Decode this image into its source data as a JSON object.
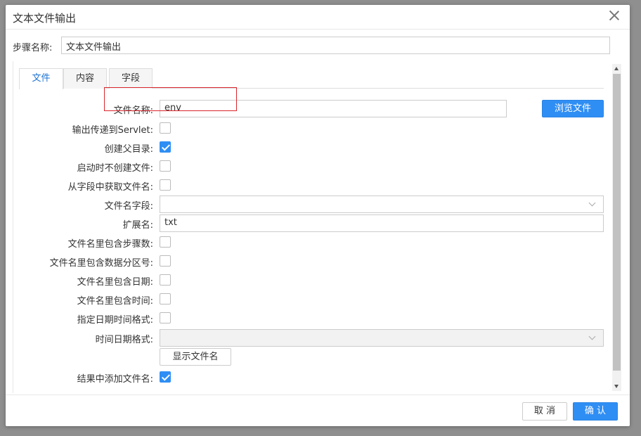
{
  "dialog": {
    "title": "文本文件输出"
  },
  "step": {
    "label": "步骤名称:",
    "value": "文本文件输出"
  },
  "tabs": [
    {
      "label": "文件"
    },
    {
      "label": "内容"
    },
    {
      "label": "字段"
    }
  ],
  "form": {
    "filename": {
      "label": "文件名称:",
      "value": "env"
    },
    "browse_label": "浏览文件",
    "servlet": {
      "label": "输出传递到Servlet:",
      "checked": false
    },
    "create_parent": {
      "label": "创建父目录:",
      "checked": true
    },
    "no_create_on_start": {
      "label": "启动时不创建文件:",
      "checked": false
    },
    "from_field": {
      "label": "从字段中获取文件名:",
      "checked": false
    },
    "filename_field": {
      "label": "文件名字段:",
      "value": ""
    },
    "extension": {
      "label": "扩展名:",
      "value": "txt"
    },
    "include_stepnr": {
      "label": "文件名里包含步骤数:",
      "checked": false
    },
    "include_partition": {
      "label": "文件名里包含数据分区号:",
      "checked": false
    },
    "include_date": {
      "label": "文件名里包含日期:",
      "checked": false
    },
    "include_time": {
      "label": "文件名里包含时间:",
      "checked": false
    },
    "specify_format": {
      "label": "指定日期时间格式:",
      "checked": false
    },
    "date_format": {
      "label": "时间日期格式:",
      "value": ""
    },
    "show_filename_label": "显示文件名",
    "add_to_result": {
      "label": "结果中添加文件名:",
      "checked": true
    }
  },
  "footer": {
    "cancel_label": "取 消",
    "ok_label": "确 认"
  }
}
